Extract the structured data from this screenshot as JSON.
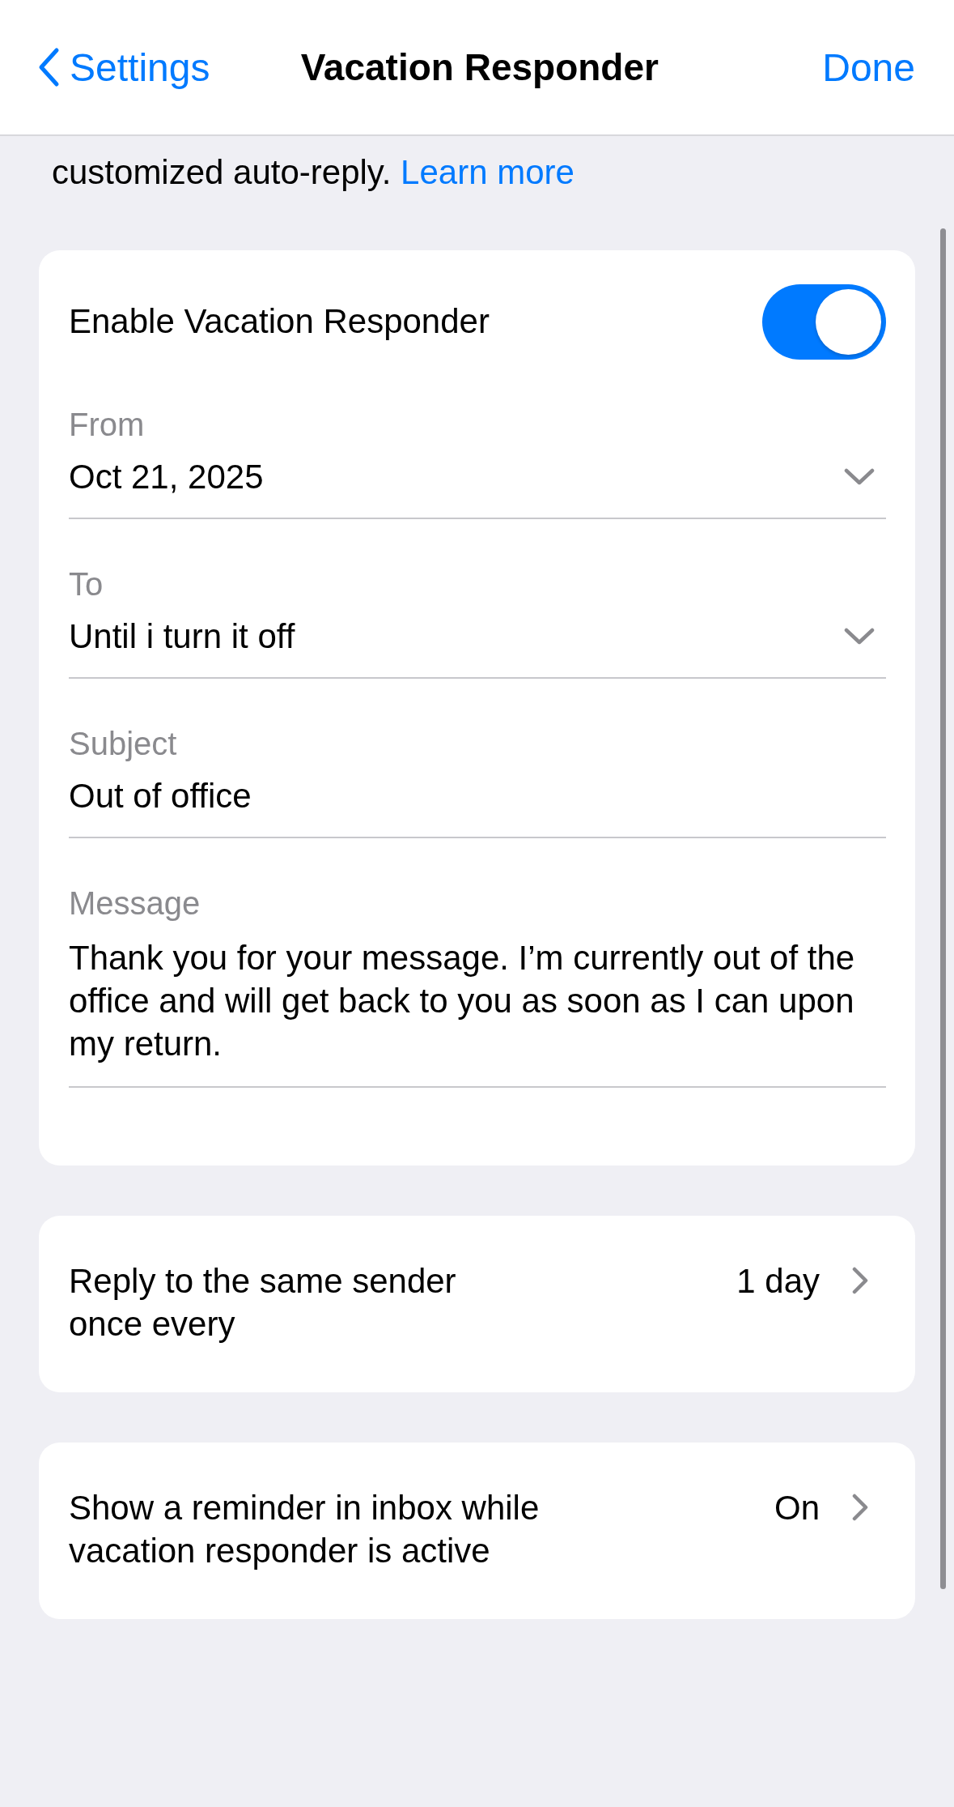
{
  "nav": {
    "back": "Settings",
    "title": "Vacation Responder",
    "done": "Done"
  },
  "intro": {
    "text": "customized auto-reply.",
    "link": "Learn more"
  },
  "enable": {
    "label": "Enable Vacation Responder",
    "on": true
  },
  "fields": [
    {
      "kind": "dropdown",
      "label": "From",
      "value": "Oct 21, 2025"
    },
    {
      "kind": "dropdown",
      "label": "To",
      "value": "Until i turn it off"
    },
    {
      "kind": "text",
      "label": "Subject",
      "value": "Out of office"
    },
    {
      "kind": "multiline",
      "label": "Message",
      "value": "Thank you for your message. I’m currently out of the office and will get back to you as soon as I can upon my return."
    }
  ],
  "settings_rows": [
    {
      "label": "Reply to the same sender\nonce every",
      "value": "1 day"
    },
    {
      "label": "Show a reminder in inbox while\nvacation responder is active",
      "value": "On"
    }
  ]
}
